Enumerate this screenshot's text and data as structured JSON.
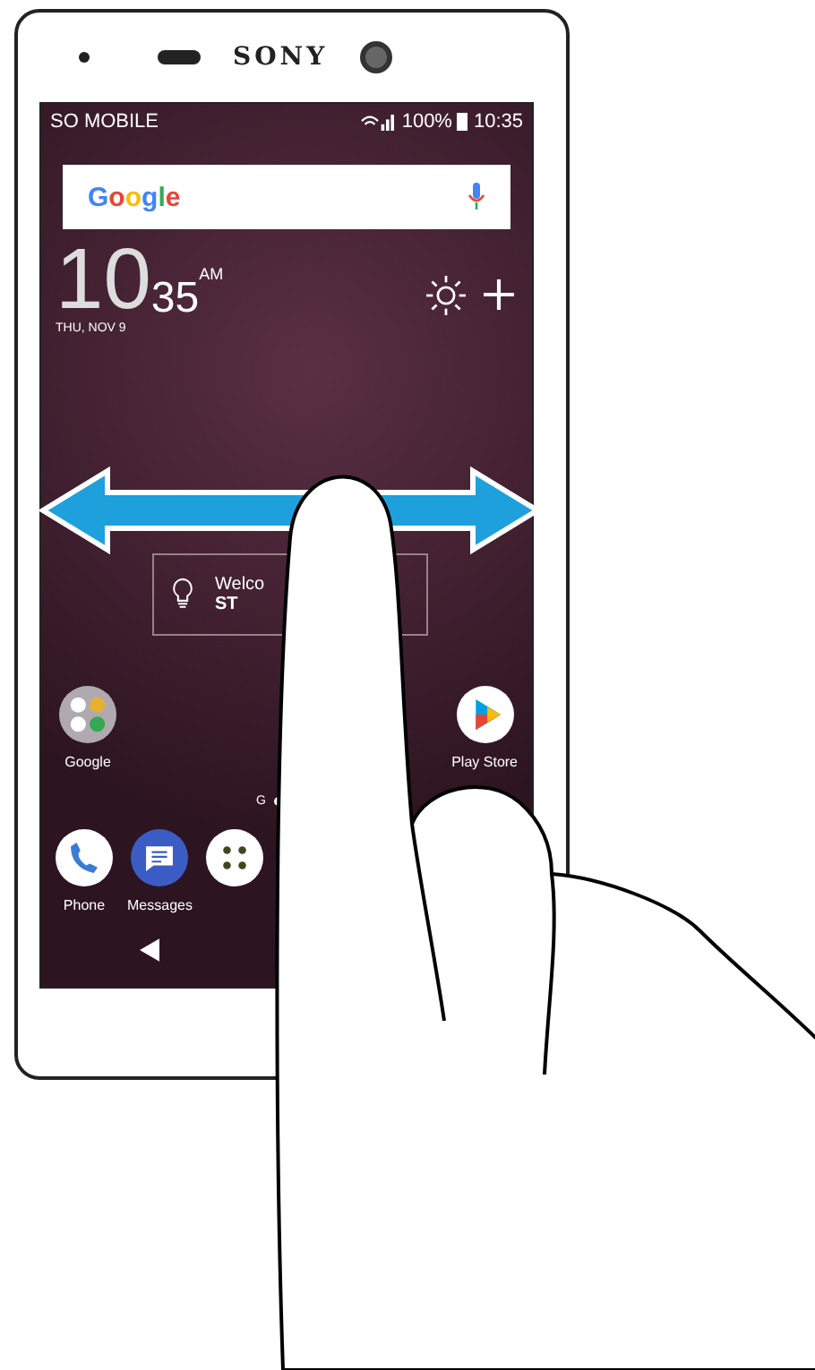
{
  "device": {
    "brand": "SONY"
  },
  "status_bar": {
    "carrier": "SO MOBILE",
    "battery": "100%",
    "time": "10:35"
  },
  "search_bar": {
    "logo": "Google"
  },
  "clock": {
    "hour": "10",
    "minute": "35",
    "ampm": "AM",
    "date": "THU, NOV 9"
  },
  "welcome_widget": {
    "line_1": "Welco",
    "line_2": "ST"
  },
  "page_indicator": {
    "label": "G"
  },
  "apps": [
    {
      "label": "Google",
      "kind": "folder"
    },
    {
      "label": "Play Store",
      "kind": "play"
    }
  ],
  "dock": [
    {
      "label": "Phone",
      "kind": "phone"
    },
    {
      "label": "Messages",
      "kind": "messages"
    },
    {
      "kind": "apps"
    }
  ]
}
